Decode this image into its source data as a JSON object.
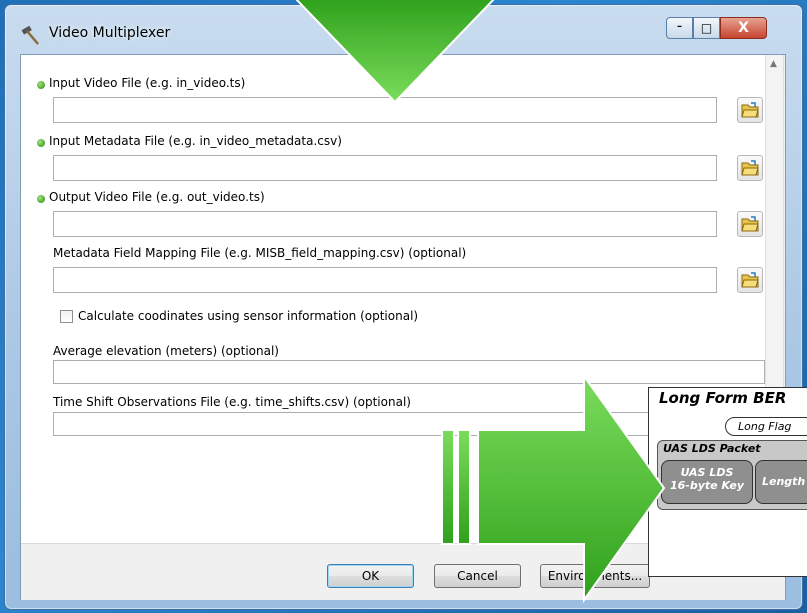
{
  "window": {
    "title": "Video Multiplexer",
    "controls": {
      "minimize": "–",
      "maximize": "□",
      "close": "X"
    }
  },
  "form": {
    "fields": [
      {
        "label": "Input Video File (e.g. in_video.ts)",
        "required": true,
        "value": ""
      },
      {
        "label": "Input Metadata File (e.g. in_video_metadata.csv)",
        "required": true,
        "value": ""
      },
      {
        "label": "Output Video File (e.g. out_video.ts)",
        "required": true,
        "value": ""
      },
      {
        "label": "Metadata Field Mapping File (e.g. MISB_field_mapping.csv) (optional)",
        "required": false,
        "value": ""
      }
    ],
    "checkbox": {
      "label": "Calculate coodinates using sensor information (optional)",
      "checked": false
    },
    "elevation": {
      "label": "Average elevation (meters) (optional)",
      "value": ""
    },
    "time_shift": {
      "label": "Time Shift Observations File (e.g. time_shifts.csv) (optional)",
      "value": ""
    }
  },
  "buttons": {
    "ok": "OK",
    "cancel": "Cancel",
    "environments": "Environments..."
  },
  "overlay": {
    "diagram": {
      "title": "Long Form BER",
      "flag": "Long Flag",
      "packet": "UAS LDS Packet",
      "key_line1": "UAS LDS",
      "key_line2": "16-byte Key",
      "length": "Length"
    }
  },
  "colors": {
    "arrow_green": "#3fb82b",
    "required_dot": "#2e8b12",
    "window_frame": "#a9c6e4"
  }
}
